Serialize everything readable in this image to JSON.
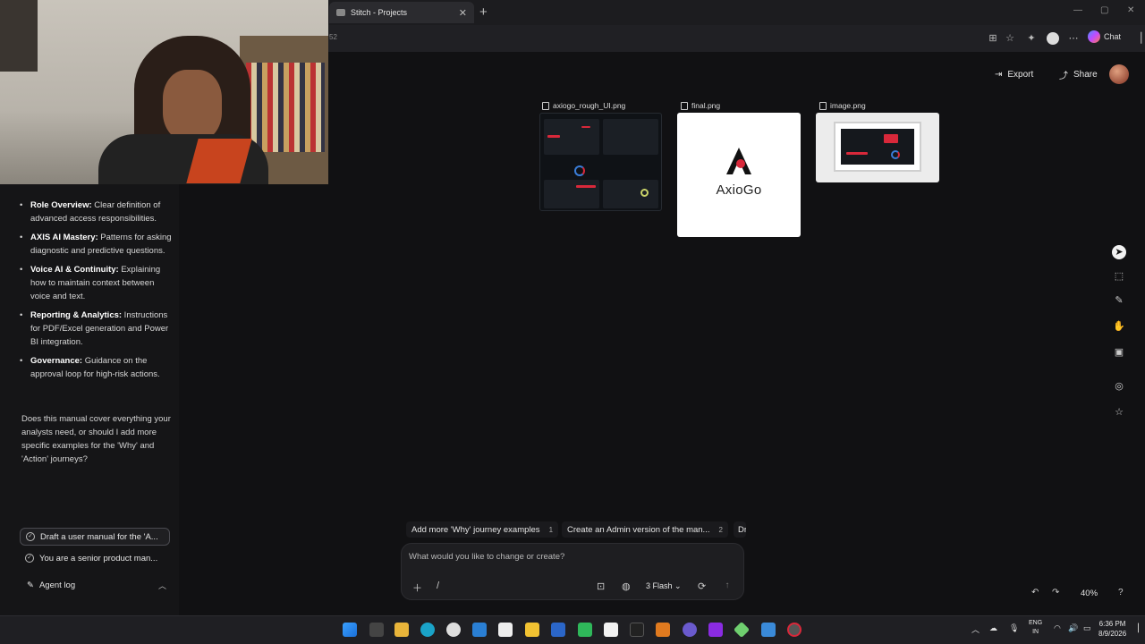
{
  "browser": {
    "tab_title": "Stitch - Projects",
    "tab_close": "✕",
    "new_tab": "+",
    "url_fragment": "52",
    "chat_label": "Chat"
  },
  "header": {
    "export_label": "Export",
    "share_label": "Share"
  },
  "chat": {
    "bullets": [
      {
        "title": "Role Overview:",
        "text": " Clear definition of advanced access responsibilities."
      },
      {
        "title": "AXIS AI Mastery:",
        "text": " Patterns for asking diagnostic and predictive questions."
      },
      {
        "title": "Voice AI & Continuity:",
        "text": " Explaining how to maintain context between voice and text."
      },
      {
        "title": "Reporting & Analytics:",
        "text": " Instructions for PDF/Excel generation and Power BI integration."
      },
      {
        "title": "Governance:",
        "text": " Guidance on the approval loop for high-risk actions."
      }
    ],
    "closing": "Does this manual cover everything your analysts need, or should I add more specific examples for the 'Why' and 'Action' journeys?"
  },
  "tasks": [
    {
      "label": "Draft a user manual for the 'A..."
    },
    {
      "label": "You are a senior product man..."
    }
  ],
  "agent_log_label": "Agent log",
  "canvas": {
    "files": [
      {
        "name": "axiogo_rough_UI.png"
      },
      {
        "name": "final.png"
      },
      {
        "name": "image.png"
      }
    ],
    "logo_text": "AxioGo"
  },
  "suggestions": [
    {
      "label": "Add more 'Why' journey examples",
      "count": "1"
    },
    {
      "label": "Create an Admin version of the man...",
      "count": "2"
    },
    {
      "label": "Dr",
      "count": ""
    }
  ],
  "prompt": {
    "placeholder": "What would you like to change or create?",
    "slash": "/",
    "model": "3 Flash"
  },
  "zoom_level": "40%",
  "taskbar": {
    "lang_line1": "ENG",
    "lang_line2": "IN",
    "time": "6:36 PM",
    "date": "8/9/2026"
  },
  "colors": {
    "accent_red": "#d8283a",
    "background": "#111113"
  }
}
